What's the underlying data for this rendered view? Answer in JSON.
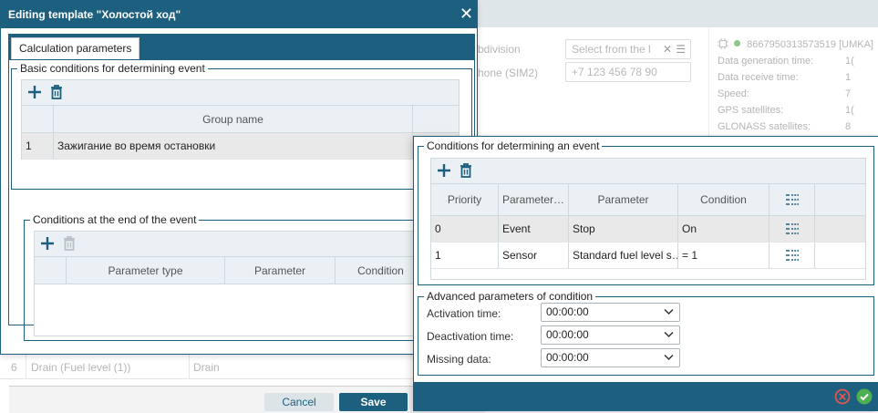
{
  "background": {
    "subdivision_label": "bdivision",
    "subdivision_placeholder": "Select from the l",
    "phone_label": "hone (SIM2)",
    "phone_placeholder": "+7 123 456 78 90",
    "device_id": "8667950313573519 [UMKA]",
    "info_rows": [
      {
        "label": "Data generation time:",
        "value": "1("
      },
      {
        "label": "Data receive time:",
        "value": "1"
      },
      {
        "label": "Speed:",
        "value": "7"
      },
      {
        "label": "GPS satellites:",
        "value": "1("
      },
      {
        "label": "GLONASS satellites:",
        "value": "8"
      }
    ],
    "table_row": {
      "num": "6",
      "name": "Drain (Fuel level (1))",
      "type": "Drain"
    }
  },
  "dialog": {
    "title": "Editing template \"Холостой ход\"",
    "close_symbol": "✕",
    "tab_label": "Calculation parameters",
    "basic_conditions": {
      "legend": "Basic conditions for determining event",
      "columns": [
        "",
        "Group name"
      ],
      "rows": [
        {
          "num": "1",
          "name": "Зажигание во время остановки"
        }
      ]
    },
    "end_conditions": {
      "legend": "Conditions at the end of the event",
      "columns": [
        "",
        "Parameter type",
        "Parameter",
        "Condition"
      ]
    },
    "cancel_label": "Cancel",
    "save_label": "Save"
  },
  "overlay": {
    "conditions": {
      "legend": "Conditions for determining an event",
      "columns": [
        "Priority",
        "Parameter…",
        "Parameter",
        "Condition"
      ],
      "rows": [
        {
          "priority": "0",
          "type": "Event",
          "parameter": "Stop",
          "condition": "On"
        },
        {
          "priority": "1",
          "type": "Sensor",
          "parameter": "Standard fuel level s…",
          "condition": "= 1"
        }
      ]
    },
    "advanced": {
      "legend": "Advanced parameters of condition",
      "fields": [
        {
          "label": "Activation time:",
          "value": "00:00:00"
        },
        {
          "label": "Deactivation time:",
          "value": "00:00:00"
        },
        {
          "label": "Missing data:",
          "value": "00:00:00"
        }
      ]
    }
  },
  "colors": {
    "primary": "#1c5f7e",
    "header_bg": "#eaf0f3",
    "selected_row": "#e9e9e9",
    "cancel_icon": "#e0574f",
    "ok_icon": "#4caf50",
    "status_dot": "#8bc78b"
  }
}
